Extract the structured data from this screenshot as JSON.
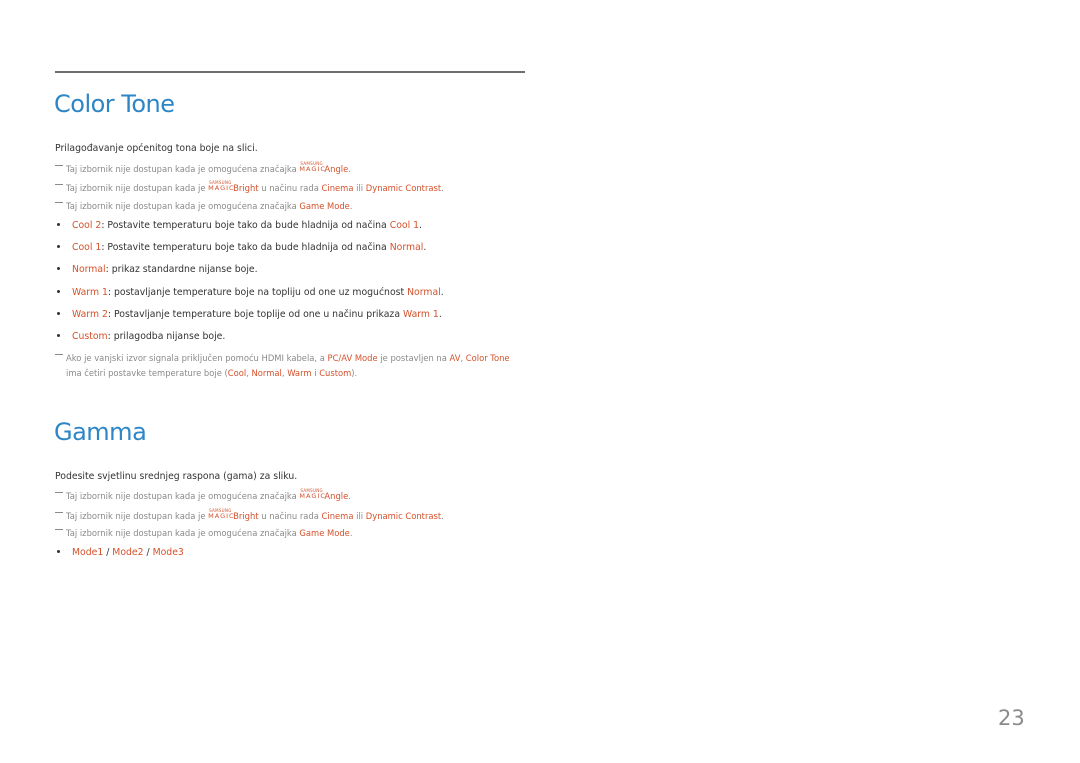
{
  "page_number": "23",
  "colors": {
    "heading": "#2d86c6",
    "highlight": "#d4512b",
    "note": "#8a8a8a",
    "body": "#333333"
  },
  "color_tone": {
    "title": "Color Tone",
    "intro": "Prilagođavanje općenitog tona boje na slici.",
    "notes": [
      {
        "pre": "Taj izbornik nije dostupan kada je omogućena značajka ",
        "logo_small": "SAMSUNG",
        "logo_big": "MAGIC",
        "hl1": "Angle",
        "post": "."
      },
      {
        "pre": "Taj izbornik nije dostupan kada je ",
        "logo_small": "SAMSUNG",
        "logo_big": "MAGIC",
        "hl1": "Bright",
        "mid1": " u načinu rada ",
        "hl2": "Cinema",
        "mid2": " ili ",
        "hl3": "Dynamic Contrast",
        "post": "."
      },
      {
        "pre": "Taj izbornik nije dostupan kada je omogućena značajka ",
        "hl1": "Game Mode",
        "post": "."
      }
    ],
    "bullets": [
      {
        "term": "Cool 2",
        "text": ": Postavite temperaturu boje tako da bude hladnija od načina ",
        "ref": "Cool 1",
        "end": "."
      },
      {
        "term": "Cool 1",
        "text": ": Postavite temperaturu boje tako da bude hladnija od načina ",
        "ref": "Normal",
        "end": "."
      },
      {
        "term": "Normal",
        "text": ": prikaz standardne nijanse boje.",
        "ref": "",
        "end": ""
      },
      {
        "term": "Warm 1",
        "text": ": postavljanje temperature boje na topliju od one uz mogućnost ",
        "ref": "Normal",
        "end": "."
      },
      {
        "term": "Warm 2",
        "text": ": Postavljanje temperature boje toplije od one u načinu prikaza ",
        "ref": "Warm 1",
        "end": "."
      },
      {
        "term": "Custom",
        "text": ": prilagodba nijanse boje.",
        "ref": "",
        "end": ""
      }
    ],
    "hdmi_note": {
      "t1": "Ako je vanjski izvor signala priključen pomoću HDMI kabela, a ",
      "h1": "PC/AV Mode",
      "t2": " je postavljen na ",
      "h2": "AV",
      "t3": ", ",
      "h3": "Color Tone",
      "t4": "ima četiri postavke temperature boje (",
      "h4": "Cool",
      "t5": ", ",
      "h5": "Normal",
      "t6": ", ",
      "h6": "Warm",
      "t7": " i ",
      "h7": "Custom",
      "t8": ")."
    }
  },
  "gamma": {
    "title": "Gamma",
    "intro": "Podesite svjetlinu srednjeg raspona (gama) za sliku.",
    "notes": [
      {
        "pre": "Taj izbornik nije dostupan kada je omogućena značajka ",
        "logo_small": "SAMSUNG",
        "logo_big": "MAGIC",
        "hl1": "Angle",
        "post": "."
      },
      {
        "pre": "Taj izbornik nije dostupan kada je ",
        "logo_small": "SAMSUNG",
        "logo_big": "MAGIC",
        "hl1": "Bright",
        "mid1": " u načinu rada ",
        "hl2": "Cinema",
        "mid2": " ili ",
        "hl3": "Dynamic Contrast",
        "post": "."
      },
      {
        "pre": "Taj izbornik nije dostupan kada je omogućena značajka ",
        "hl1": "Game Mode",
        "post": "."
      }
    ],
    "modes": {
      "m1": "Mode1",
      "sep1": " / ",
      "m2": "Mode2",
      "sep2": " / ",
      "m3": "Mode3"
    }
  }
}
